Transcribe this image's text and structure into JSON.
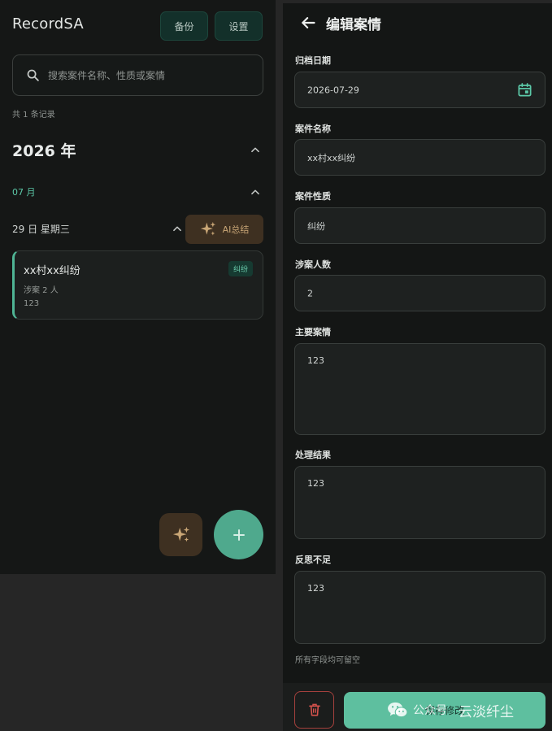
{
  "colors": {
    "accent": "#5ebf9f",
    "warm_accent": "#c9a676",
    "danger": "#d5524c",
    "background": "#151716"
  },
  "list": {
    "app_title": "RecordSA",
    "backup_label": "备份",
    "settings_label": "设置",
    "search": {
      "placeholder": "搜索案件名称、性质或案情",
      "value": ""
    },
    "record_count": "共 1 条记录",
    "year_label": "2026 年",
    "month_label": "07 月",
    "day_label": "29 日 星期三",
    "ai_summary_label": "AI总结",
    "case": {
      "title": "xx村xx纠纷",
      "tag": "纠纷",
      "people": "涉案 2 人",
      "desc": "123"
    },
    "icons": {
      "search": "search-icon",
      "collapse": "chevron-up-icon",
      "ai": "sparkle-icon",
      "add": "plus-icon"
    }
  },
  "edit": {
    "title": "编辑案情",
    "archive_date_label": "归档日期",
    "archive_date": "2026-07-29",
    "case_name_label": "案件名称",
    "case_name": "xx村xx纠纷",
    "case_type_label": "案件性质",
    "case_type": "纠纷",
    "people_count_label": "涉案人数",
    "people_count": "2",
    "main_facts_label": "主要案情",
    "main_facts": "123",
    "result_label": "处理结果",
    "result": "123",
    "reflection_label": "反思不足",
    "reflection": "123",
    "hint": "所有字段均可留空",
    "save_label": "保存修改",
    "icons": {
      "back": "arrow-left-icon",
      "calendar": "calendar-icon",
      "delete": "trash-icon"
    }
  },
  "watermark": {
    "account_label": "公众号",
    "name": "云淡纤尘"
  }
}
